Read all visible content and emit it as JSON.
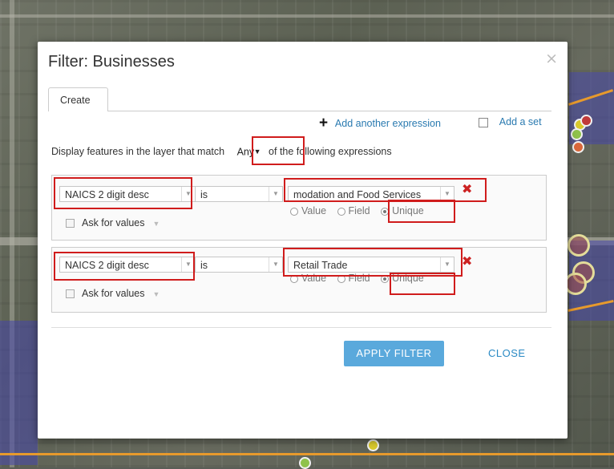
{
  "dialog": {
    "title": "Filter: Businesses",
    "close_glyph": "×",
    "tab_label": "Create",
    "add_expression_label": "Add another expression",
    "add_set_label": "Add a set",
    "match_prefix": "Display features in the layer that match",
    "match_value": "Any",
    "match_suffix": "of the following expressions",
    "expressions": [
      {
        "field": "NAICS 2 digit desc",
        "operator": "is",
        "value": "modation and Food Services",
        "radio_options": [
          "Value",
          "Field",
          "Unique"
        ],
        "selected_radio": "Unique",
        "ask_label": "Ask for values"
      },
      {
        "field": "NAICS 2 digit desc",
        "operator": "is",
        "value": "Retail Trade",
        "radio_options": [
          "Value",
          "Field",
          "Unique"
        ],
        "selected_radio": "Unique",
        "ask_label": "Ask for values"
      }
    ],
    "apply_label": "APPLY FILTER",
    "close_label": "CLOSE"
  },
  "icons": {
    "close": "close-icon",
    "plus": "plus-icon",
    "delete": "delete-expression-icon",
    "dropdown": "chevron-down-icon"
  },
  "colors": {
    "accent": "#5aa9dc",
    "link": "#2a7ab0",
    "highlight": "#d01c1c",
    "delete": "#cc2222"
  }
}
